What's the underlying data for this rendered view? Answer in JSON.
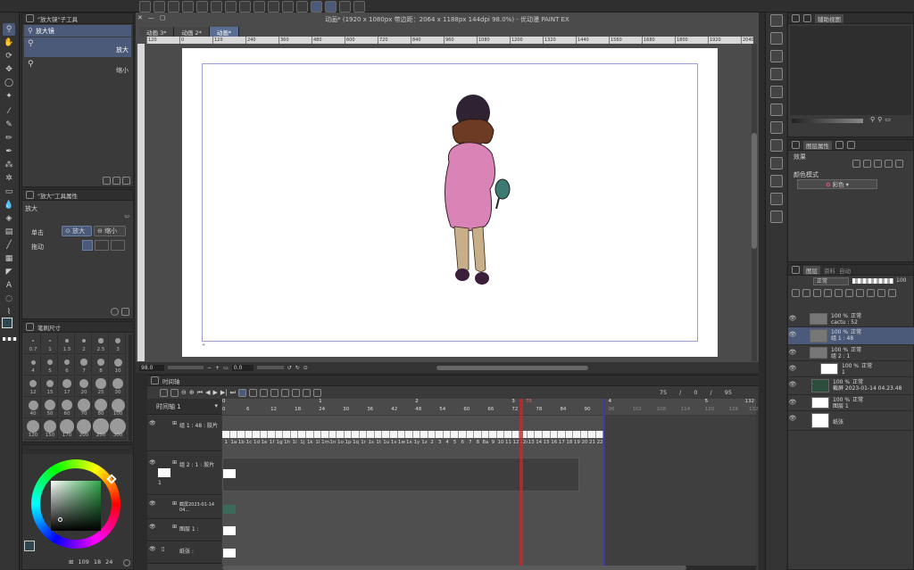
{
  "window": {
    "title": "动画* (1920 x 1080px 带边距：2064 x 1188px 144dpi 98.0%) - 优动漫 PAINT EX"
  },
  "canvas_tabs": [
    {
      "label": "动画 3*",
      "active": false
    },
    {
      "label": "动画 2*",
      "active": false
    },
    {
      "label": "动画*",
      "active": true
    }
  ],
  "ruler_top": [
    "120",
    "0",
    "120",
    "240",
    "360",
    "480",
    "600",
    "720",
    "840",
    "960",
    "1080",
    "1200",
    "1320",
    "1440",
    "1560",
    "1680",
    "1800",
    "1920",
    "2040"
  ],
  "subtool_panel": {
    "header": "\"放大镜\"子工具",
    "items": [
      {
        "label": "放大镜",
        "right": ""
      },
      {
        "label": "",
        "right": "放大"
      },
      {
        "label": "",
        "right": "缩小"
      }
    ]
  },
  "tool_property": {
    "header": "\"放大\"工具属性",
    "subtitle": "放大",
    "click_label": "单击",
    "click_zoom_in": "放大",
    "click_zoom_out": "缩小",
    "drag_label": "拖动"
  },
  "brush_size": {
    "header": "笔刷尺寸",
    "row1": [
      "0.7",
      "1",
      "1.5",
      "2",
      "2.5",
      "3"
    ],
    "row2": [
      "4",
      "5",
      "6",
      "7",
      "8",
      "10"
    ],
    "row3": [
      "12",
      "15",
      "17",
      "20",
      "25",
      "30"
    ],
    "row4": [
      "40",
      "50",
      "60",
      "70",
      "80",
      "100"
    ],
    "row5": [
      "120",
      "150",
      "170",
      "200",
      "250",
      "300"
    ]
  },
  "color_footer": {
    "values": [
      "109",
      "18",
      "24"
    ]
  },
  "canvas_status": {
    "zoom": "98.0",
    "angle": "0.0"
  },
  "timeline": {
    "header": "时间轴",
    "track_name": "时间轴 1",
    "counter": [
      "75",
      "0",
      "95"
    ],
    "second_markers": [
      "0",
      "1",
      "2",
      "3",
      "4",
      "5"
    ],
    "frame_ticks": [
      "0",
      "6",
      "12",
      "18",
      "24",
      "30",
      "36",
      "42",
      "48",
      "54",
      "60",
      "66",
      "72",
      "78",
      "84",
      "90",
      "96",
      "102",
      "108",
      "114",
      "120",
      "126",
      "132"
    ],
    "playhead": "75",
    "end_marker": "132",
    "tracks": [
      {
        "name": "组 1 : 48 : 胶片",
        "sub": ""
      },
      {
        "name": "组 2 : 1 : 胶片",
        "sub": "1"
      },
      {
        "name": "截屏2023-01-14 04...",
        "sub": ""
      },
      {
        "name": "图层 1 :",
        "sub": ""
      },
      {
        "name": "纸张 :",
        "sub": ""
      }
    ],
    "cels_a": [
      "1",
      "1a",
      "1b",
      "1c",
      "1d",
      "1e",
      "1f",
      "1g",
      "1h",
      "1i",
      "1j",
      "1k",
      "1l",
      "1m",
      "1n",
      "1o",
      "1p",
      "1q",
      "1r",
      "1s",
      "1t",
      "1u",
      "1v",
      "1w",
      "1x",
      "1y",
      "1z",
      "2",
      "3",
      "4",
      "5",
      "6",
      "7",
      "8",
      "8a",
      "9",
      "10",
      "11",
      "12",
      "12a",
      "13",
      "14",
      "15",
      "16",
      "17",
      "18",
      "19",
      "20",
      "21",
      "22",
      "23"
    ]
  },
  "right_panel": {
    "nav_tab": "辅助视图",
    "layer_prop_tab": "图层属性",
    "effect_label": "效果",
    "color_mode_label": "颜色模式",
    "color_mode_value": "彩色",
    "layer_tabs": [
      "图层",
      "资料",
      "自动"
    ],
    "blend_mode": "正常",
    "opacity": "100",
    "layers": [
      {
        "pct": "100 %",
        "mode": "正常",
        "name": "cactu : 52"
      },
      {
        "pct": "100 %",
        "mode": "正常",
        "name": "组 1 : 48"
      },
      {
        "pct": "100 %",
        "mode": "正常",
        "name": "组 2 : 1"
      },
      {
        "pct": "100 %",
        "mode": "正常",
        "name": "1"
      },
      {
        "pct": "100 %",
        "mode": "正常",
        "name": "截屏 2023-01-14 04.23.48"
      },
      {
        "pct": "100 %",
        "mode": "正常",
        "name": "图层 1"
      },
      {
        "pct": "",
        "mode": "",
        "name": "纸张"
      }
    ]
  },
  "colors": {
    "accent": "#5a6e94",
    "playhead": "#c0282d",
    "end_line": "#3a3aa8",
    "frame_guide": "#9b9bd6"
  }
}
